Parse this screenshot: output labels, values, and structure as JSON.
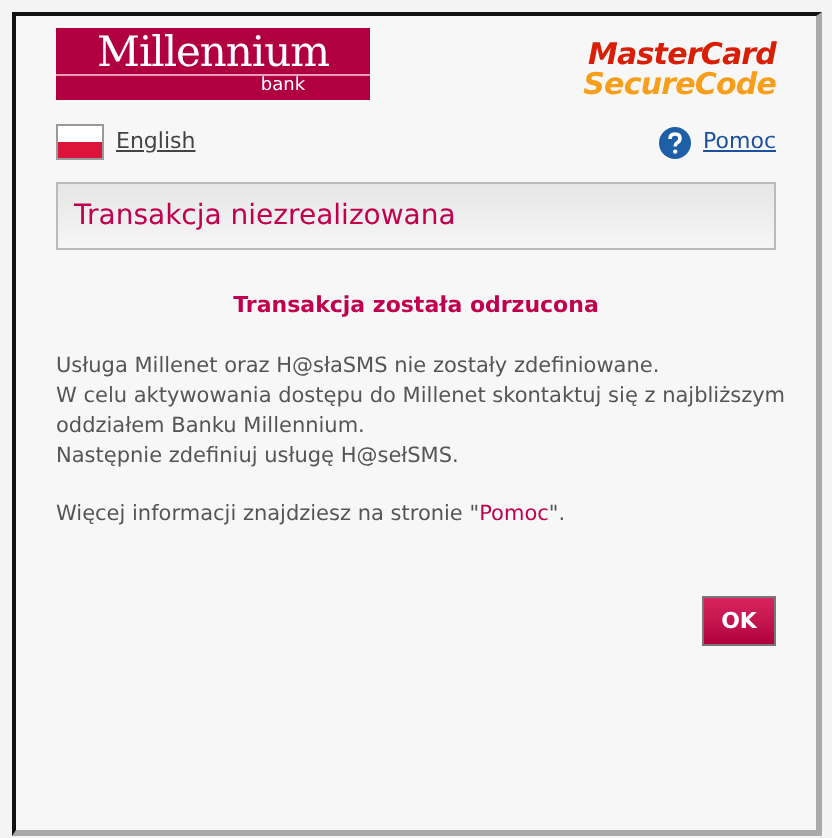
{
  "bank_logo": {
    "name": "Millennium",
    "subtitle": "bank"
  },
  "card_logo": {
    "line_1": "MasterCard",
    "line_2": "SecureCode"
  },
  "language_link": "English",
  "help_link": "Pomoc",
  "header": "Transakcja niezrealizowana",
  "message_title": "Transakcja została odrzucona",
  "message_lines": [
    "Usługa Millenet oraz H@słaSMS nie zostały zdefiniowane.",
    "W celu aktywowania dostępu do Millenet skontaktuj się z najbliższym oddziałem Banku Millennium.",
    "Następnie zdefiniuj usługę H@sełSMS."
  ],
  "more_info": {
    "before": "Więcej informacji znajdziesz na stronie \"",
    "link": "Pomoc",
    "after": "\"."
  },
  "ok_button": "OK"
}
